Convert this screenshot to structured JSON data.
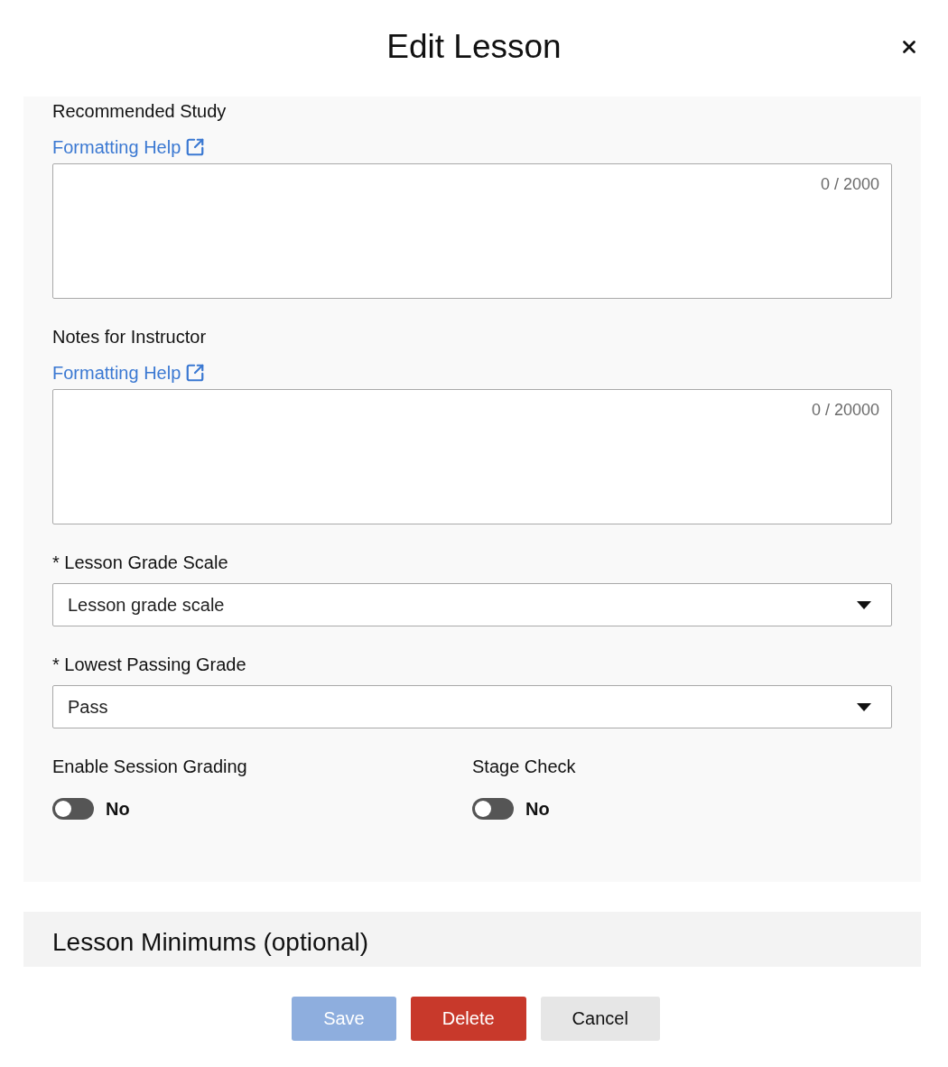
{
  "dialog": {
    "title": "Edit Lesson"
  },
  "text_areas": [
    {
      "label": "Recommended Study",
      "help_link": "Formatting Help",
      "counter": "0 / 2000"
    },
    {
      "label": "Notes for Instructor",
      "help_link": "Formatting Help",
      "counter": "0 / 20000"
    }
  ],
  "selects": [
    {
      "label": "* Lesson Grade Scale",
      "value": "Lesson grade scale"
    },
    {
      "label": "* Lowest Passing Grade",
      "value": "Pass"
    }
  ],
  "toggles": [
    {
      "label": "Enable Session Grading",
      "on": false,
      "state_text": "No"
    },
    {
      "label": "Stage Check",
      "on": false,
      "state_text": "No"
    }
  ],
  "section": {
    "title": "Lesson Minimums (optional)"
  },
  "buttons": [
    {
      "label": "Save",
      "kind": "primary",
      "disabled": true
    },
    {
      "label": "Delete",
      "kind": "danger",
      "disabled": false
    },
    {
      "label": "Cancel",
      "kind": "secondary",
      "disabled": false
    }
  ]
}
